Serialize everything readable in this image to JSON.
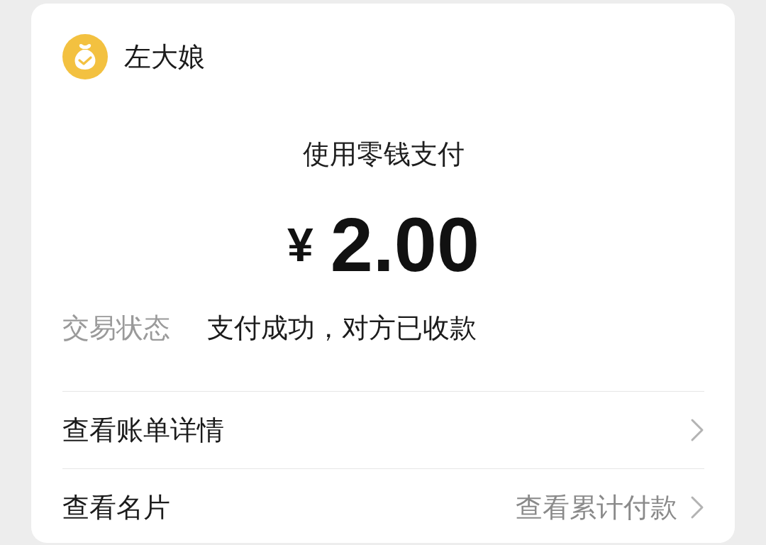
{
  "merchant": {
    "name": "左大娘"
  },
  "payment": {
    "method": "使用零钱支付",
    "currency": "¥",
    "amount": "2.00"
  },
  "details": [
    {
      "label": "交易状态",
      "value": "支付成功，对方已收款"
    }
  ],
  "links": [
    {
      "label": "查看账单详情"
    },
    {
      "label": "查看名片",
      "hint": "查看累计付款"
    }
  ]
}
